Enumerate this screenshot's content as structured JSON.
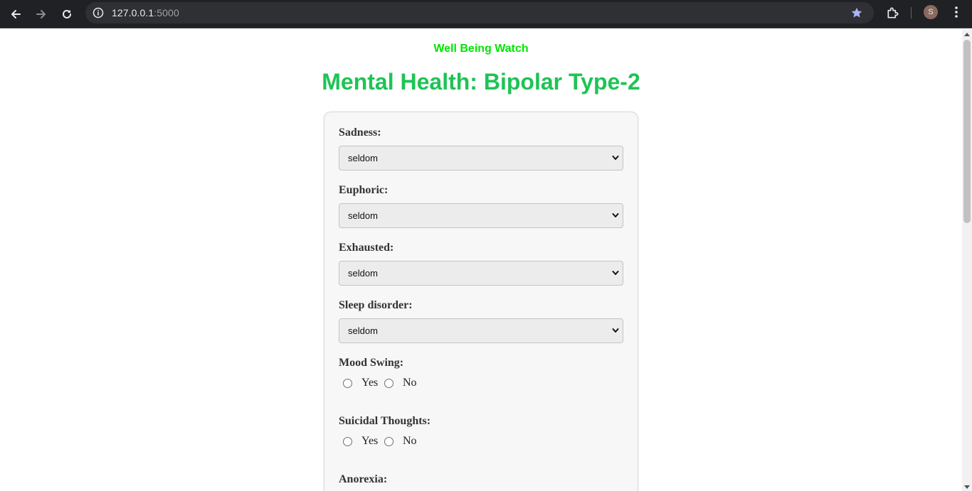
{
  "browser": {
    "url_host": "127.0.0.1",
    "url_port": ":5000",
    "profile_initial": "S",
    "icons": [
      "back-arrow-icon",
      "forward-arrow-icon",
      "reload-icon",
      "info-icon",
      "star-icon",
      "extensions-icon",
      "menu-icon"
    ]
  },
  "header": {
    "brand": "Well Being Watch",
    "title": "Mental Health: Bipolar Type-2"
  },
  "form": {
    "sadness": {
      "label": "Sadness:",
      "value": "seldom"
    },
    "euphoric": {
      "label": "Euphoric:",
      "value": "seldom"
    },
    "exhausted": {
      "label": "Exhausted:",
      "value": "seldom"
    },
    "sleep_disorder": {
      "label": "Sleep disorder:",
      "value": "seldom"
    },
    "mood_swing": {
      "label": "Mood Swing:",
      "yes": "Yes",
      "no": "No"
    },
    "suicidal_thoughts": {
      "label": "Suicidal Thoughts:",
      "yes": "Yes",
      "no": "No"
    },
    "anorexia": {
      "label": "Anorexia:"
    }
  },
  "colors": {
    "brand": "#00e600",
    "title": "#1fc355",
    "browser_bar": "#202124",
    "card_bg": "#f7f7f7"
  }
}
